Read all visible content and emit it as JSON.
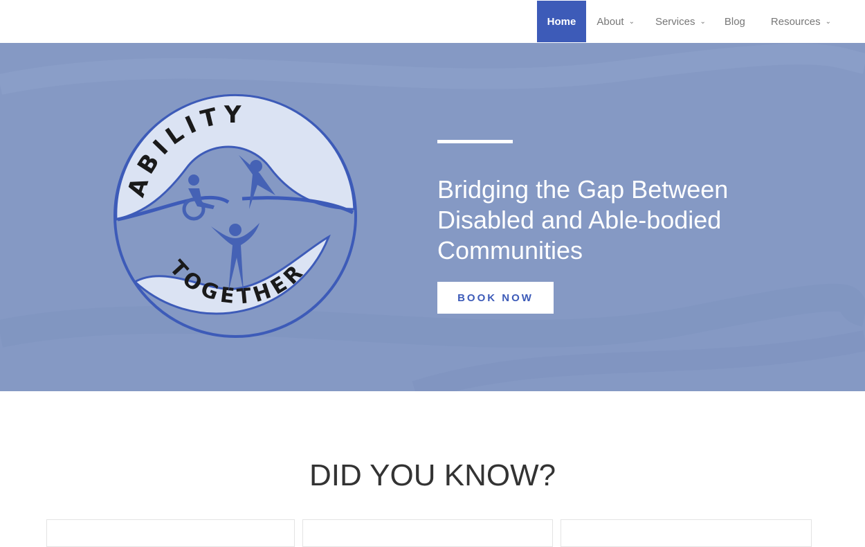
{
  "nav": {
    "items": [
      {
        "label": "Home",
        "active": true,
        "dropdown": false
      },
      {
        "label": "About",
        "dropdown": true
      },
      {
        "label": "Services",
        "dropdown": true
      },
      {
        "label": "Blog",
        "dropdown": false
      },
      {
        "label": "Resources",
        "dropdown": true
      }
    ]
  },
  "hero": {
    "logo": {
      "top_text": "ABILITY",
      "bottom_text": "TOGETHER"
    },
    "headline": "Bridging the Gap Between Disabled and Able-bodied Communities",
    "cta": "BOOK NOW",
    "colors": {
      "background": "#8599c4",
      "accent": "#3d5bb8"
    }
  },
  "section": {
    "title": "DID YOU KNOW?"
  }
}
